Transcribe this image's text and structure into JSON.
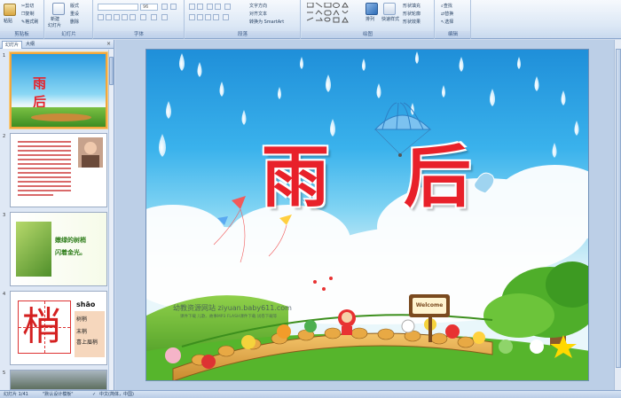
{
  "ribbon": {
    "clipboard": {
      "paste": "粘贴",
      "cut": "剪切",
      "copy": "复制",
      "format_painter": "格式刷",
      "label": "剪贴板"
    },
    "slides": {
      "new_slide": "新建",
      "new_slide_2": "幻灯片",
      "layout": "版式",
      "reset": "重设",
      "delete": "删除",
      "label": "幻灯片"
    },
    "font": {
      "font_size": "96",
      "label": "字体"
    },
    "paragraph": {
      "text_direction": "文字方向",
      "align_text": "对齐文本",
      "smartart": "转换为 SmartArt",
      "label": "段落"
    },
    "drawing": {
      "arrange": "排列",
      "quick_styles": "快速样式",
      "shape_fill": "形状填充",
      "shape_outline": "形状轮廓",
      "shape_effects": "形状效果",
      "label": "绘图"
    },
    "editing": {
      "find": "查找",
      "replace": "替换",
      "select": "选择",
      "label": "编辑"
    }
  },
  "panel": {
    "tabs": [
      "幻灯片",
      "大纲"
    ],
    "close": "×",
    "slides": [
      {
        "num": "1",
        "title": "雨 后"
      },
      {
        "num": "2"
      },
      {
        "num": "3",
        "text_line1": "嫩绿的树梢",
        "text_line2": "闪着金光。"
      },
      {
        "num": "4",
        "char": "梢",
        "pinyin": "shāo",
        "words": [
          "树梢",
          "末梢",
          "喜上眉梢"
        ]
      },
      {
        "num": "5"
      }
    ]
  },
  "slide": {
    "title_char1": "雨",
    "title_char2": "后",
    "watermark_main": "幼教资源网站  ziyuan.baby611.com",
    "watermark_sub": "课件下载  儿歌、故事MP3  FLASH课件下载  试卷下载等",
    "sign": "Welcome"
  },
  "status": {
    "slide_pos": "幻灯片 1/41",
    "theme": "\"默认设计模板\"",
    "language": "中文(简体，中国)"
  },
  "colors": {
    "accent": "#f2a73d",
    "title_red": "#e8212a",
    "ribbon_blue": "#1e395b"
  }
}
